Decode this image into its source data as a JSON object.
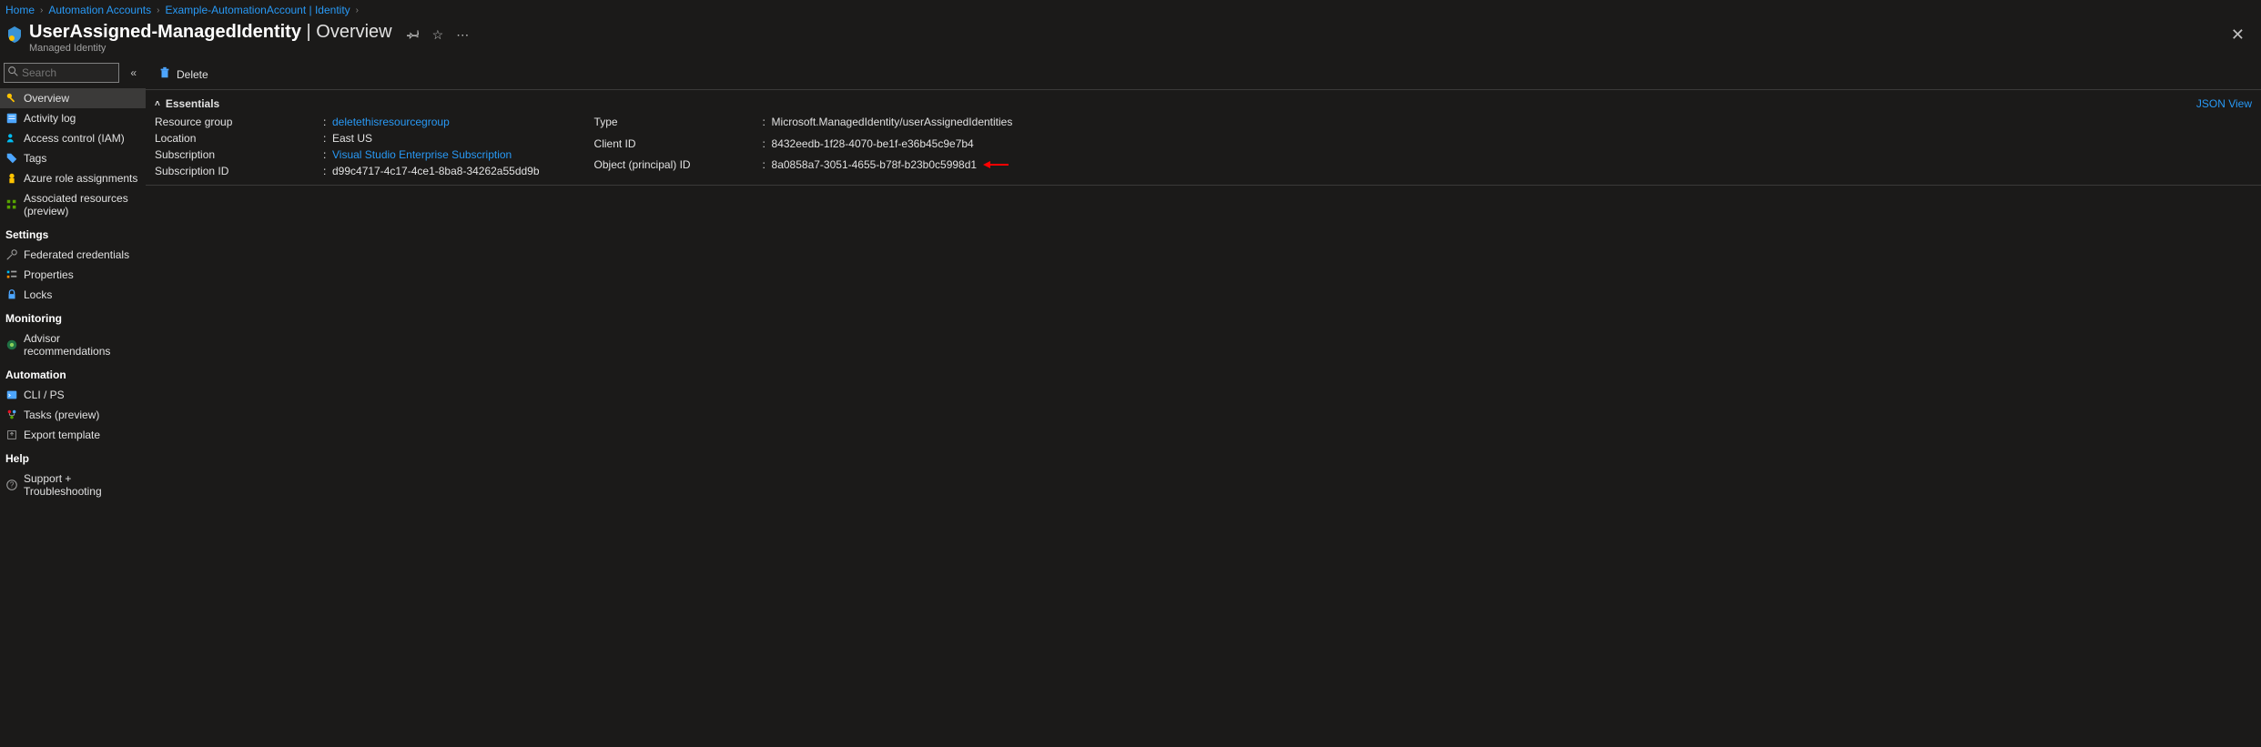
{
  "breadcrumb": [
    {
      "label": "Home"
    },
    {
      "label": "Automation Accounts"
    },
    {
      "label": "Example-AutomationAccount | Identity"
    }
  ],
  "header": {
    "title_main": "UserAssigned-ManagedIdentity",
    "title_suffix": " | Overview",
    "subtitle": "Managed Identity"
  },
  "search": {
    "placeholder": "Search"
  },
  "nav": {
    "top": [
      {
        "name": "overview",
        "label": "Overview",
        "active": true
      },
      {
        "name": "activity-log",
        "label": "Activity log"
      },
      {
        "name": "access-control",
        "label": "Access control (IAM)"
      },
      {
        "name": "tags",
        "label": "Tags"
      },
      {
        "name": "azure-role",
        "label": "Azure role assignments"
      },
      {
        "name": "assoc-resources",
        "label": "Associated resources (preview)"
      }
    ],
    "sections": [
      {
        "title": "Settings",
        "items": [
          {
            "name": "federated",
            "label": "Federated credentials"
          },
          {
            "name": "properties",
            "label": "Properties"
          },
          {
            "name": "locks",
            "label": "Locks"
          }
        ]
      },
      {
        "title": "Monitoring",
        "items": [
          {
            "name": "advisor",
            "label": "Advisor recommendations"
          }
        ]
      },
      {
        "title": "Automation",
        "items": [
          {
            "name": "clips",
            "label": "CLI / PS"
          },
          {
            "name": "tasks",
            "label": "Tasks (preview)"
          },
          {
            "name": "export",
            "label": "Export template"
          }
        ]
      },
      {
        "title": "Help",
        "items": [
          {
            "name": "support",
            "label": "Support + Troubleshooting"
          }
        ]
      }
    ]
  },
  "toolbar": {
    "delete": "Delete"
  },
  "essentials": {
    "title": "Essentials",
    "json_view": "JSON View",
    "left": [
      {
        "label": "Resource group",
        "value": "deletethisresourcegroup",
        "link": true
      },
      {
        "label": "Location",
        "value": "East US"
      },
      {
        "label": "Subscription",
        "value": "Visual Studio Enterprise Subscription",
        "link": true
      },
      {
        "label": "Subscription ID",
        "value": "d99c4717-4c17-4ce1-8ba8-34262a55dd9b"
      }
    ],
    "right": [
      {
        "label": "Type",
        "value": "Microsoft.ManagedIdentity/userAssignedIdentities"
      },
      {
        "label": "Client ID",
        "value": "8432eedb-1f28-4070-be1f-e36b45c9e7b4"
      },
      {
        "label": "Object (principal) ID",
        "value": "8a0858a7-3051-4655-b78f-b23b0c5998d1",
        "arrow": true
      }
    ]
  }
}
